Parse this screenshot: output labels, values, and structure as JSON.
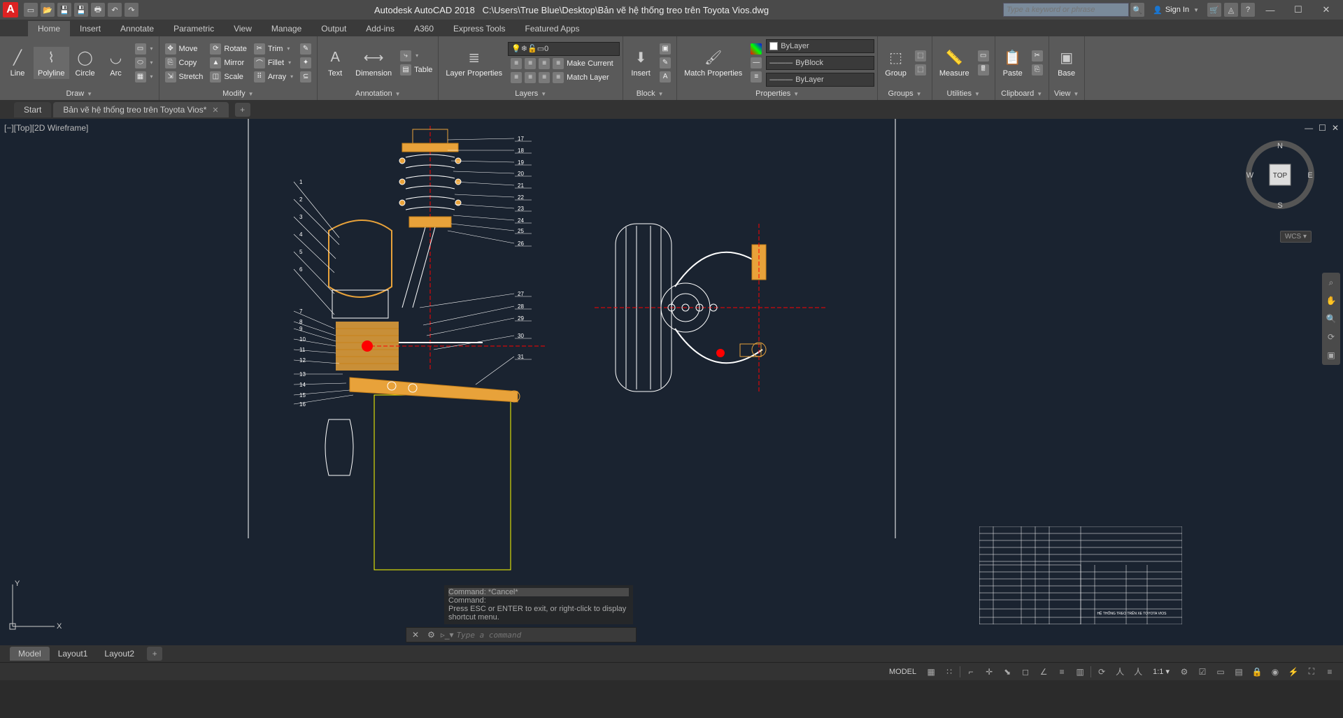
{
  "title": {
    "app": "Autodesk AutoCAD 2018",
    "file": "C:\\Users\\True Blue\\Desktop\\Bản vẽ hệ thống treo trên Toyota Vios.dwg"
  },
  "search": {
    "placeholder": "Type a keyword or phrase"
  },
  "signin": "Sign In",
  "ribbon_tabs": [
    "Home",
    "Insert",
    "Annotate",
    "Parametric",
    "View",
    "Manage",
    "Output",
    "Add-ins",
    "A360",
    "Express Tools",
    "Featured Apps"
  ],
  "panels": {
    "draw": {
      "title": "Draw",
      "items": [
        "Line",
        "Polyline",
        "Circle",
        "Arc"
      ]
    },
    "modify": {
      "title": "Modify",
      "items": [
        "Move",
        "Rotate",
        "Trim",
        "Copy",
        "Mirror",
        "Fillet",
        "Stretch",
        "Scale",
        "Array"
      ]
    },
    "annotation": {
      "title": "Annotation",
      "items": [
        "Text",
        "Dimension",
        "Table"
      ]
    },
    "layers": {
      "title": "Layers",
      "lp": "Layer Properties",
      "current": "0",
      "mc": "Make Current",
      "ml": "Match Layer"
    },
    "block": {
      "title": "Block",
      "insert": "Insert"
    },
    "properties": {
      "title": "Properties",
      "mp": "Match Properties",
      "bylayer": "ByLayer",
      "byblock": "ByBlock"
    },
    "groups": {
      "title": "Groups",
      "g": "Group"
    },
    "utilities": {
      "title": "Utilities",
      "m": "Measure"
    },
    "clipboard": {
      "title": "Clipboard",
      "p": "Paste"
    },
    "view": {
      "title": "View",
      "b": "Base"
    }
  },
  "file_tabs": {
    "start": "Start",
    "doc": "Bản vẽ hệ thống treo trên Toyota Vios*"
  },
  "view_label": "[−][Top][2D Wireframe]",
  "viewcube": {
    "top": "TOP",
    "n": "N",
    "s": "S",
    "e": "E",
    "w": "W"
  },
  "wcs": "WCS",
  "ucs": {
    "x": "X",
    "y": "Y"
  },
  "callouts_left": [
    "1",
    "2",
    "3",
    "4",
    "5",
    "6",
    "7",
    "8",
    "9",
    "10",
    "11",
    "12",
    "13",
    "14",
    "15",
    "16"
  ],
  "callouts_right_a": [
    "17",
    "18",
    "19",
    "20",
    "21",
    "22",
    "23",
    "24",
    "25",
    "26"
  ],
  "callouts_right_b": [
    "27",
    "28",
    "29",
    "30",
    "31"
  ],
  "cmd": {
    "hist1": "Command: *Cancel*",
    "hist2": "Command:",
    "hist3": "Press ESC or ENTER to exit, or right-click to display shortcut menu.",
    "placeholder": "Type a command"
  },
  "layout_tabs": [
    "Model",
    "Layout1",
    "Layout2"
  ],
  "status": {
    "model": "MODEL",
    "scale": "1:1"
  },
  "title_block": "HỆ THỐNG TREO TRÊN XE TOYOTA VIOS"
}
